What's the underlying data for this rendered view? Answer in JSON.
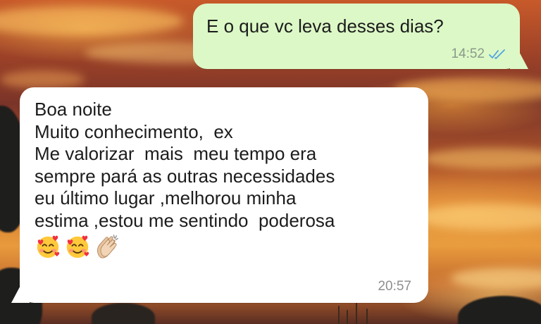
{
  "conversation": {
    "outgoing": {
      "text": "E o que vc leva desses dias?",
      "time": "14:52",
      "status_icon": "double-check-read-icon"
    },
    "incoming": {
      "lines": [
        "Boa noite",
        "Muito conhecimento,  ex",
        "Me valorizar  mais  meu tempo era",
        "sempre pará as outras necessidades",
        "eu último lugar ,melhorou minha",
        "estima ,estou me sentindo  poderosa"
      ],
      "emojis": [
        "smiling-face-with-hearts-emoji",
        "smiling-face-with-hearts-emoji",
        "clapping-hands-emoji"
      ],
      "time": "20:57"
    }
  },
  "colors": {
    "outgoing_bubble": "#dcf8c6",
    "incoming_bubble": "#ffffff",
    "read_ticks": "#4fa3e0"
  }
}
